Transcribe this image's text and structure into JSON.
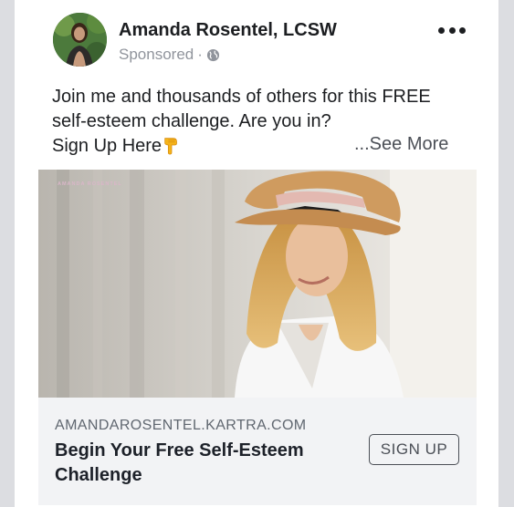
{
  "post": {
    "author": "Amanda Rosentel, LCSW",
    "sponsored_label": "Sponsored",
    "meta_separator": " ·",
    "privacy_icon": "globe-icon",
    "more_icon": "more-options-icon",
    "text_line_1": "Join me and thousands of others for this FREE",
    "text_line_2": "self-esteem challenge. Are you in?",
    "text_line_3": "Sign Up Here",
    "text_emoji_icon": "pointing-down-hand-icon",
    "see_more_label": "...See More"
  },
  "ad_image": {
    "brand_text": "AMANDA ROSENTEL"
  },
  "link_preview": {
    "domain": "AMANDAROSENTEL.KARTRA.COM",
    "headline": "Begin Your Free Self-Esteem Challenge",
    "cta_label": "SIGN UP"
  },
  "colors": {
    "page_bg": "#dcdde1",
    "card_bg": "#ffffff",
    "link_bar_bg": "#f2f3f5",
    "secondary_text": "#90949c",
    "see_more": "#4b4f56",
    "emoji": "#f5b31a"
  }
}
